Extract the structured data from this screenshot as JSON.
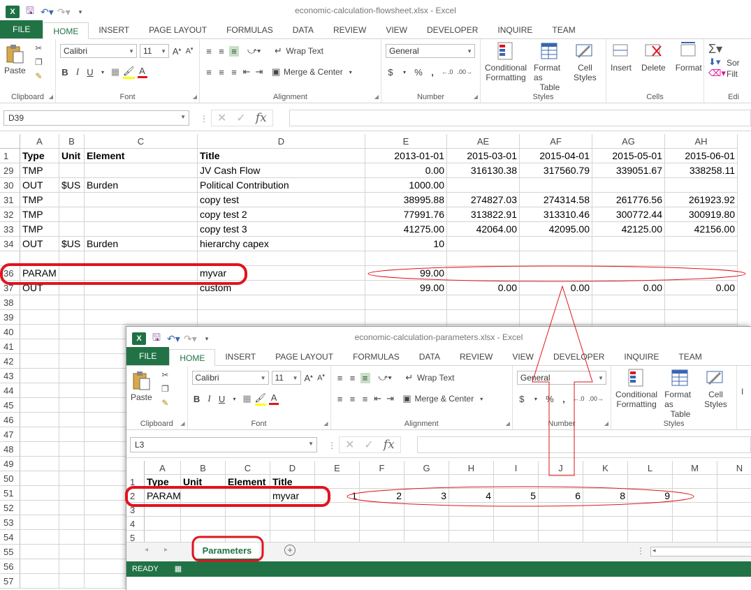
{
  "main": {
    "title": "economic-calculation-flowsheet.xlsx - Excel",
    "tabs": [
      "FILE",
      "HOME",
      "INSERT",
      "PAGE LAYOUT",
      "FORMULAS",
      "DATA",
      "REVIEW",
      "VIEW",
      "DEVELOPER",
      "INQUIRE",
      "TEAM"
    ],
    "active_tab": "HOME",
    "ribbon": {
      "clipboard": {
        "label": "Clipboard",
        "paste": "Paste"
      },
      "font": {
        "label": "Font",
        "name": "Calibri",
        "size": "11",
        "bold": "B",
        "italic": "I",
        "underline": "U"
      },
      "alignment": {
        "label": "Alignment",
        "wrap": "Wrap Text",
        "merge": "Merge & Center"
      },
      "number": {
        "label": "Number",
        "format": "General",
        "currency": "$",
        "percent": "%",
        "comma": ","
      },
      "styles": {
        "label": "Styles",
        "cond": [
          "Conditional",
          "Formatting"
        ],
        "table": [
          "Format as",
          "Table"
        ],
        "cell": [
          "Cell",
          "Styles"
        ]
      },
      "cells": {
        "label": "Cells",
        "insert": "Insert",
        "delete": "Delete",
        "format": "Format"
      },
      "editing": {
        "sort": "Sor",
        "filter": "Filt",
        "label": "Edi"
      }
    },
    "name_box": "D39",
    "fx": "fx",
    "columns": [
      "A",
      "B",
      "C",
      "D",
      "E",
      "AE",
      "AF",
      "AG",
      "AH"
    ],
    "rows": [
      {
        "n": "1",
        "cells": [
          "Type",
          "Unit",
          "Element",
          "Title",
          "2013-01-01",
          "2015-03-01",
          "2015-04-01",
          "2015-05-01",
          "2015-06-01"
        ]
      },
      {
        "n": "29",
        "cells": [
          "TMP",
          "",
          "",
          "JV Cash Flow",
          "0.00",
          "316130.38",
          "317560.79",
          "339051.67",
          "338258.11"
        ]
      },
      {
        "n": "30",
        "cells": [
          "OUT",
          "$US",
          "Burden",
          "Political Contribution",
          "1000.00",
          "",
          "",
          "",
          ""
        ]
      },
      {
        "n": "31",
        "cells": [
          "TMP",
          "",
          "",
          "copy test",
          "38995.88",
          "274827.03",
          "274314.58",
          "261776.56",
          "261923.92"
        ]
      },
      {
        "n": "32",
        "cells": [
          "TMP",
          "",
          "",
          "copy test 2",
          "77991.76",
          "313822.91",
          "313310.46",
          "300772.44",
          "300919.80"
        ]
      },
      {
        "n": "33",
        "cells": [
          "TMP",
          "",
          "",
          "copy test 3",
          "41275.00",
          "42064.00",
          "42095.00",
          "42125.00",
          "42156.00"
        ]
      },
      {
        "n": "34",
        "cells": [
          "OUT",
          "$US",
          "Burden",
          "hierarchy capex",
          "10",
          "",
          "",
          "",
          ""
        ]
      },
      {
        "n": "",
        "cells": [
          "",
          "",
          "",
          "",
          "",
          "",
          "",
          "",
          ""
        ]
      },
      {
        "n": "36",
        "cells": [
          "PARAM",
          "",
          "",
          "myvar",
          "99.00",
          "",
          "",
          "",
          ""
        ]
      },
      {
        "n": "37",
        "cells": [
          "OUT",
          "",
          "",
          "custom",
          "99.00",
          "0.00",
          "0.00",
          "0.00",
          "0.00"
        ]
      },
      {
        "n": "38",
        "cells": [
          "",
          "",
          "",
          "",
          "",
          "",
          "",
          "",
          ""
        ]
      },
      {
        "n": "39",
        "cells": [
          "",
          "",
          "",
          "",
          "",
          "",
          "",
          "",
          ""
        ]
      },
      {
        "n": "40",
        "cells": []
      },
      {
        "n": "41",
        "cells": []
      },
      {
        "n": "42",
        "cells": []
      },
      {
        "n": "43",
        "cells": []
      },
      {
        "n": "44",
        "cells": []
      },
      {
        "n": "45",
        "cells": []
      },
      {
        "n": "46",
        "cells": []
      },
      {
        "n": "47",
        "cells": []
      },
      {
        "n": "48",
        "cells": []
      },
      {
        "n": "49",
        "cells": []
      },
      {
        "n": "50",
        "cells": []
      },
      {
        "n": "51",
        "cells": []
      },
      {
        "n": "52",
        "cells": []
      },
      {
        "n": "53",
        "cells": []
      },
      {
        "n": "54",
        "cells": []
      },
      {
        "n": "55",
        "cells": []
      },
      {
        "n": "56",
        "cells": []
      },
      {
        "n": "57",
        "cells": []
      }
    ]
  },
  "params": {
    "title": "economic-calculation-parameters.xlsx - Excel",
    "tabs": [
      "FILE",
      "HOME",
      "INSERT",
      "PAGE LAYOUT",
      "FORMULAS",
      "DATA",
      "REVIEW",
      "VIEW",
      "DEVELOPER",
      "INQUIRE",
      "TEAM"
    ],
    "active_tab": "HOME",
    "ribbon": {
      "clipboard": {
        "label": "Clipboard",
        "paste": "Paste"
      },
      "font": {
        "label": "Font",
        "name": "Calibri",
        "size": "11",
        "bold": "B",
        "italic": "I",
        "underline": "U"
      },
      "alignment": {
        "label": "Alignment",
        "wrap": "Wrap Text",
        "merge": "Merge & Center"
      },
      "number": {
        "label": "Number",
        "format": "General",
        "currency": "$",
        "percent": "%",
        "comma": ","
      },
      "styles": {
        "label": "Styles",
        "cond": [
          "Conditional",
          "Formatting"
        ],
        "table": [
          "Format as",
          "Table"
        ],
        "cell": [
          "Cell",
          "Styles"
        ]
      },
      "extra": "I"
    },
    "name_box": "L3",
    "fx": "fx",
    "columns": [
      "A",
      "B",
      "C",
      "D",
      "E",
      "F",
      "G",
      "H",
      "I",
      "J",
      "K",
      "L",
      "M",
      "N"
    ],
    "rows": [
      {
        "n": "1",
        "cells": [
          "Type",
          "Unit",
          "Element",
          "Title",
          "",
          "",
          "",
          "",
          "",
          "",
          "",
          "",
          "",
          ""
        ]
      },
      {
        "n": "2",
        "cells": [
          "PARAM",
          "",
          "",
          "myvar",
          "1",
          "2",
          "3",
          "4",
          "5",
          "6",
          "8",
          "9",
          "",
          ""
        ]
      },
      {
        "n": "3",
        "cells": []
      },
      {
        "n": "4",
        "cells": []
      },
      {
        "n": "5",
        "cells": []
      }
    ],
    "sheet_tab": "Parameters",
    "status": "READY"
  },
  "colors": {
    "excel_green": "#217346",
    "annotation_red": "#e0141e"
  }
}
